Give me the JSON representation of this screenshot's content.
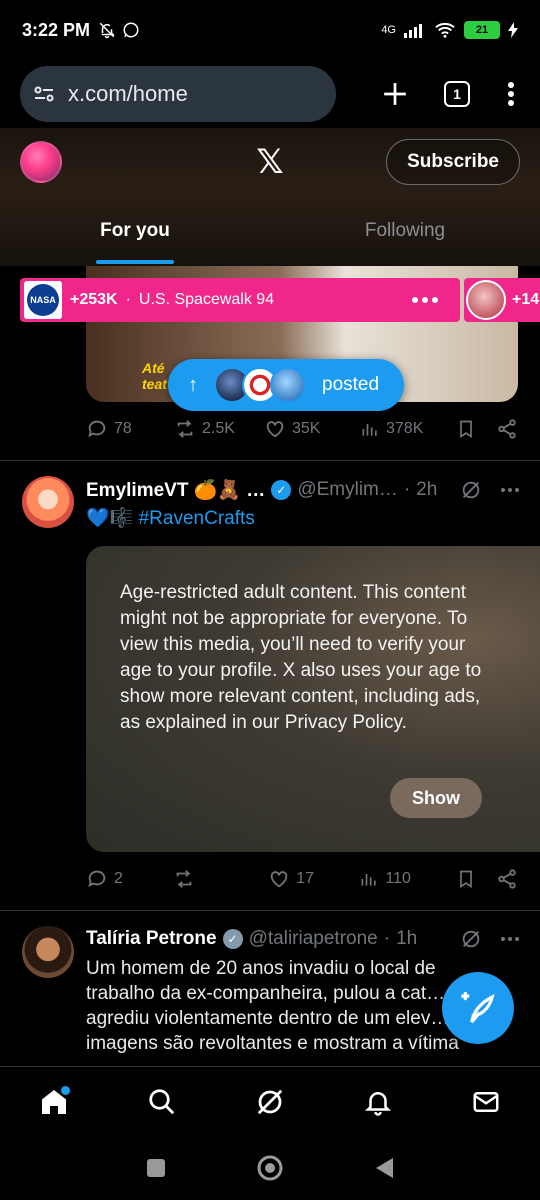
{
  "status_bar": {
    "time": "3:22 PM",
    "network": "4G",
    "battery": "21"
  },
  "browser": {
    "url": "x.com/home",
    "tab_count": "1"
  },
  "header": {
    "logo": "𝕏",
    "subscribe_label": "Subscribe"
  },
  "tabs": [
    {
      "label": "For you",
      "active": true
    },
    {
      "label": "Following",
      "active": false
    }
  ],
  "spaces": {
    "primary": {
      "logo_text": "NASA",
      "count": "+253K",
      "separator": "·",
      "title": "U.S. Spacewalk 94"
    },
    "secondary": {
      "count": "+14"
    }
  },
  "previous_tweet": {
    "media_caption_line1": "Até",
    "media_caption_line2": "teat",
    "replies": "78",
    "reposts": "2.5K",
    "likes": "35K",
    "views": "378K"
  },
  "posted_pill": {
    "label": "posted"
  },
  "tweets": [
    {
      "name": "EmylimeVT 🍊🧸 …",
      "handle": "@Emylim…",
      "dot": "·",
      "time": "2h",
      "text_prefix": "💙🎼",
      "hashtag": "#RavenCrafts",
      "age_notice": "Age-restricted adult content. This content might not be appropriate for everyone. To view this media, you’ll need to verify your age to your profile. X also uses your age to show more relevant content, including ads, as explained in our Privacy Policy.",
      "show_label": "Show",
      "replies": "2",
      "reposts": "",
      "likes": "17",
      "views": "110"
    },
    {
      "name": "Talíria Petrone",
      "handle": "@taliriapetrone",
      "dot": "·",
      "time": "1h",
      "text": "Um homem de 20 anos invadiu o local de trabalho da ex-companheira, pulou a cat… agrediu violentamente dentro de um elev… s imagens são revoltantes e mostram a vítima"
    }
  ],
  "colors": {
    "accent": "#1d9bf0",
    "spaces": "#f0268a",
    "background": "#000000"
  }
}
